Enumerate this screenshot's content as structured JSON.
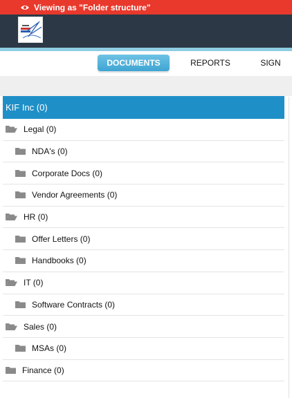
{
  "banner": {
    "text": "Viewing as \"Folder structure\"",
    "icon": "eye-icon"
  },
  "nav": {
    "tabs": [
      {
        "label": "DOCUMENTS",
        "active": true
      },
      {
        "label": "REPORTS",
        "active": false
      },
      {
        "label": "SIGN",
        "active": false
      }
    ]
  },
  "tree": {
    "root": "KIF Inc (0)",
    "items": [
      {
        "label": "Legal (0)",
        "level": 1,
        "icon": "folder-open-icon"
      },
      {
        "label": "NDA's (0)",
        "level": 2,
        "icon": "folder-icon"
      },
      {
        "label": "Corporate Docs (0)",
        "level": 2,
        "icon": "folder-icon"
      },
      {
        "label": "Vendor Agreements (0)",
        "level": 2,
        "icon": "folder-icon"
      },
      {
        "label": "HR (0)",
        "level": 1,
        "icon": "folder-open-icon"
      },
      {
        "label": "Offer Letters (0)",
        "level": 2,
        "icon": "folder-icon"
      },
      {
        "label": "Handbooks (0)",
        "level": 2,
        "icon": "folder-icon"
      },
      {
        "label": "IT (0)",
        "level": 1,
        "icon": "folder-open-icon"
      },
      {
        "label": "Software Contracts (0)",
        "level": 2,
        "icon": "folder-icon"
      },
      {
        "label": "Sales (0)",
        "level": 1,
        "icon": "folder-open-icon"
      },
      {
        "label": "MSAs (0)",
        "level": 2,
        "icon": "folder-icon"
      },
      {
        "label": "Finance (0)",
        "level": 1,
        "icon": "folder-icon"
      }
    ]
  },
  "colors": {
    "banner": "#e8392c",
    "header": "#2d3846",
    "accent": "#1f8fc7",
    "folder": "#8a8a8a"
  }
}
